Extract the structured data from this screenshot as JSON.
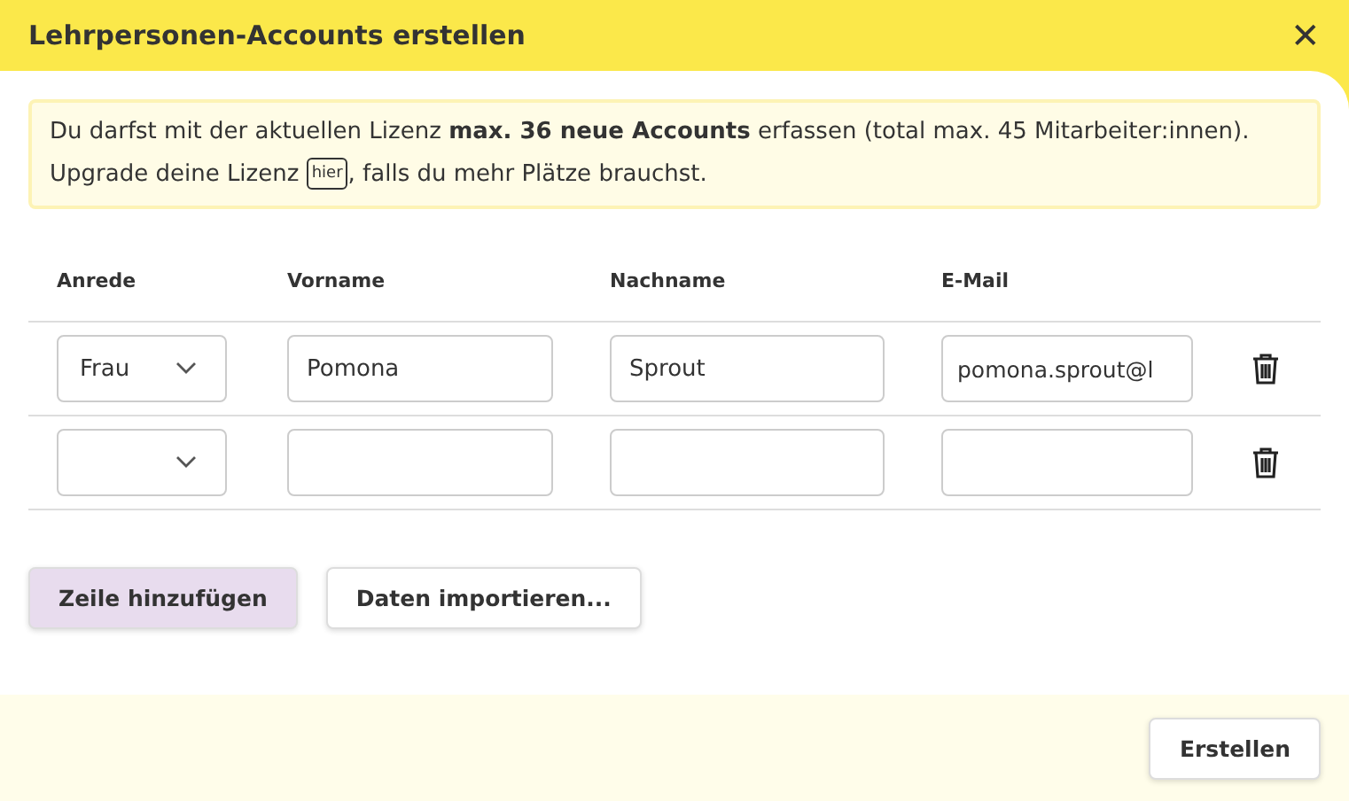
{
  "dialog": {
    "title": "Lehrpersonen-Accounts erstellen",
    "close": "✕"
  },
  "notice": {
    "text_before": "Du darfst mit der aktuellen Lizenz **max. 36 neue Accounts** erfassen (total max. 45 Mitarbeiter:innen). Upgrade deine Lizenz ",
    "link": "hier",
    "text_after": ", falls du mehr Plätze brauchst."
  },
  "table": {
    "columns": [
      "Anrede",
      "Vorname",
      "Nachname",
      "E-Mail"
    ],
    "rows": [
      {
        "anrede": "Frau",
        "vorname": "Pomona",
        "nachname": "Sprout",
        "email": "pomona.sprout@l"
      },
      {
        "anrede": "",
        "vorname": "",
        "nachname": "",
        "email": ""
      }
    ]
  },
  "buttons": [
    {
      "label": "Zeile hinzufügen",
      "kind": "primary"
    },
    {
      "label": "Daten importieren...",
      "kind": "secondary"
    }
  ],
  "footer": {
    "submit": "Erstellen"
  }
}
